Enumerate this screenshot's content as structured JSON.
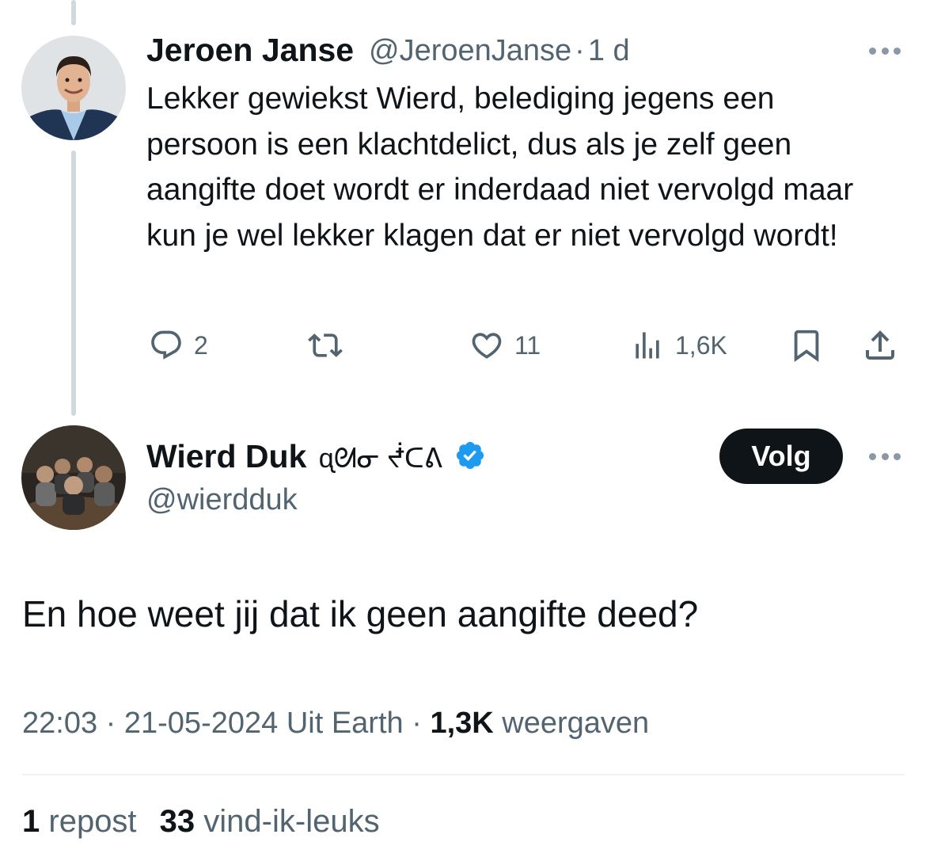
{
  "reply_parent": {
    "author_name": "Jeroen Janse",
    "author_handle": "@JeroenJanse",
    "separator": "·",
    "time": "1 d",
    "text": "Lekker gewiekst Wierd, belediging jegens een persoon is een klachtdelict, dus als je zelf geen aangifte doet wordt er inderdaad  niet vervolgd maar kun je wel lekker klagen dat er niet vervolgd wordt!",
    "actions": {
      "replies": "2",
      "reposts": "",
      "likes": "11",
      "views": "1,6K"
    }
  },
  "main_tweet": {
    "author_name": "Wierd Duk",
    "name_glyphs": "ᶐᘛᓂ ᖫᑕᕕ",
    "author_handle": "@wierdduk",
    "verified": true,
    "follow_label": "Volg",
    "text": "En hoe weet jij dat ik geen aangifte deed?",
    "time": "22:03",
    "date": "21-05-2024",
    "source": "Uit Earth",
    "views_count": "1,3K",
    "views_label": "weergaven",
    "reposts_count": "1",
    "reposts_label": "repost",
    "likes_count": "33",
    "likes_label": "vind-ik-leuks"
  },
  "colors": {
    "text": "#0f1419",
    "secondary": "#536471",
    "thread_line": "#cfd9de",
    "verified_badge": "#1d9bf0",
    "follow_button_bg": "#0f1419"
  },
  "icons": [
    "reply-icon",
    "repost-icon",
    "like-icon",
    "views-icon",
    "bookmark-icon",
    "share-icon",
    "more-icon",
    "verified-badge-icon"
  ]
}
